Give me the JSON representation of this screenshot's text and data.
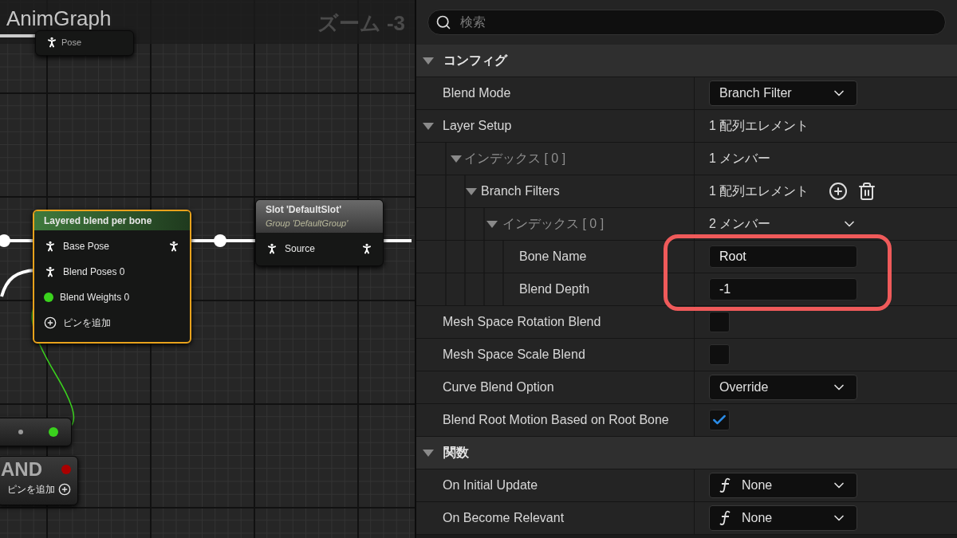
{
  "graph": {
    "title": "AnimGraph",
    "zoom": "ズーム -3",
    "nodes": [
      {
        "kind": "result",
        "selected": false,
        "pins": [
          {
            "label": "Pose",
            "kind": "pose"
          }
        ]
      },
      {
        "kind": "blend",
        "title": "Layered blend per bone",
        "selected": true,
        "pins": [
          {
            "label": "Base Pose",
            "kind": "pose",
            "output": true
          },
          {
            "label": "Blend Poses 0",
            "kind": "pose",
            "output": false
          },
          {
            "label": "Blend Weights 0",
            "kind": "float",
            "output": false
          }
        ],
        "add_pin": "ピンを追加"
      },
      {
        "kind": "slot",
        "title": "Slot 'DefaultSlot'",
        "subtitle": "Group 'DefaultGroup'",
        "selected": false,
        "pins": [
          {
            "label": "Source",
            "kind": "pose",
            "output": true
          }
        ]
      },
      {
        "kind": "compact",
        "selected": false
      },
      {
        "kind": "logic",
        "title": "AND",
        "selected": false,
        "add_pin": "ピンを追加"
      }
    ]
  },
  "details": {
    "search": {
      "placeholder": "検索"
    },
    "highlight": {
      "color": "#ef5a5a"
    },
    "rows": [
      {
        "kind": "category",
        "label": "コンフィグ",
        "expanded": true,
        "children": [
          {
            "kind": "dropdown",
            "label": "Blend Mode",
            "value": "Branch Filter"
          },
          {
            "kind": "array",
            "label": "Layer Setup",
            "value": "1 配列エレメント",
            "expanded": true,
            "actions": false,
            "children": [
              {
                "kind": "struct",
                "label": "インデックス [ 0 ]",
                "value": "1 メンバー",
                "expanded": true,
                "menu": false,
                "children": [
                  {
                    "kind": "array",
                    "label": "Branch Filters",
                    "value": "1 配列エレメント",
                    "expanded": true,
                    "actions": true,
                    "children": [
                      {
                        "kind": "struct",
                        "label": "インデックス [ 0 ]",
                        "value": "2 メンバー",
                        "expanded": true,
                        "menu": true,
                        "children": [
                          {
                            "kind": "text",
                            "label": "Bone Name",
                            "value": "Root"
                          },
                          {
                            "kind": "text",
                            "label": "Blend Depth",
                            "value": "-1"
                          }
                        ]
                      }
                    ]
                  }
                ]
              }
            ]
          },
          {
            "kind": "checkbox",
            "label": "Mesh Space Rotation Blend",
            "checked": false
          },
          {
            "kind": "checkbox",
            "label": "Mesh Space Scale Blend",
            "checked": false
          },
          {
            "kind": "dropdown",
            "label": "Curve Blend Option",
            "value": "Override"
          },
          {
            "kind": "checkbox",
            "label": "Blend Root Motion Based on Root Bone",
            "checked": true
          }
        ]
      },
      {
        "kind": "category",
        "label": "関数",
        "expanded": true,
        "children": [
          {
            "kind": "function",
            "label": "On Initial Update",
            "value": "None"
          },
          {
            "kind": "function",
            "label": "On Become Relevant",
            "value": "None"
          }
        ]
      }
    ]
  }
}
